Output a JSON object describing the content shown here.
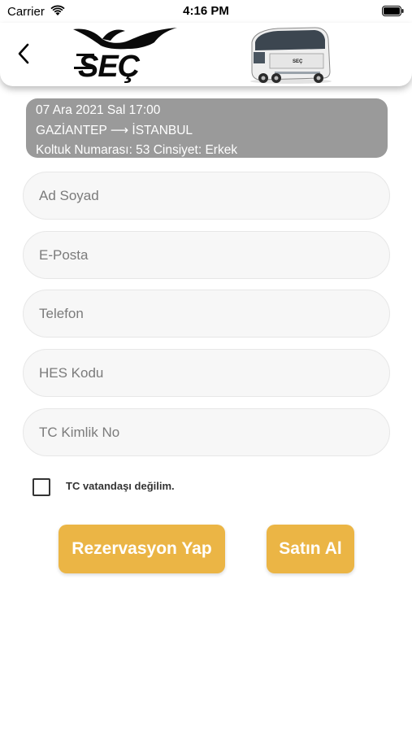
{
  "status_bar": {
    "carrier": "Carrier",
    "time": "4:16 PM"
  },
  "header": {
    "back_icon": "chevron-left-icon",
    "logo_text": "SEÇ"
  },
  "trip": {
    "datetime": "07 Ara 2021 Sal 17:00",
    "route": "GAZİANTEP ⟶ İSTANBUL",
    "seat_info": "Koltuk Numarası: 53 Cinsiyet: Erkek"
  },
  "form": {
    "name_placeholder": "Ad Soyad",
    "email_placeholder": "E-Posta",
    "phone_placeholder": "Telefon",
    "hes_placeholder": "HES Kodu",
    "tc_placeholder": "TC Kimlik No",
    "not_citizen_label": "TC vatandaşı değilim."
  },
  "actions": {
    "reserve_label": "Rezervasyon Yap",
    "buy_label": "Satın Al"
  },
  "colors": {
    "accent": "#ebb545",
    "card": "#9a9a9a",
    "field_bg": "#f7f7f7"
  }
}
